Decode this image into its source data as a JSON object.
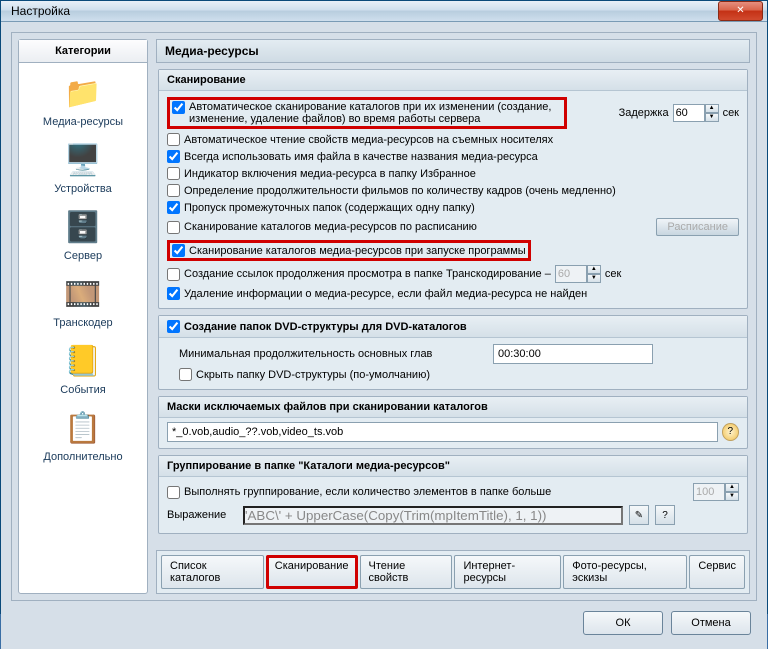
{
  "window": {
    "title": "Настройка"
  },
  "sidebar": {
    "tab": "Категории",
    "items": [
      {
        "label": "Медиа-ресурсы"
      },
      {
        "label": "Устройства"
      },
      {
        "label": "Сервер"
      },
      {
        "label": "Транскодер"
      },
      {
        "label": "События"
      },
      {
        "label": "Дополнительно"
      }
    ]
  },
  "content": {
    "title": "Медиа-ресурсы",
    "scan": {
      "header": "Сканирование",
      "c1": "Автоматическое сканирование каталогов при их изменении (создание, изменение, удаление файлов) во время работы сервера",
      "delay_label": "Задержка",
      "delay_value": "60",
      "delay_unit": "сек",
      "c2": "Автоматическое чтение свойств медиа-ресурсов на съемных носителях",
      "c3": "Всегда использовать имя файла в качестве названия медиа-ресурса",
      "c4": "Индикатор включения медиа-ресурса в папку Избранное",
      "c5": "Определение продолжительности фильмов по количеству кадров (очень медленно)",
      "c6": "Пропуск промежуточных папок  (содержащих одну папку)",
      "c7": "Сканирование каталогов медиа-ресурсов по расписанию",
      "sched_btn": "Расписание",
      "c8": "Сканирование каталогов медиа-ресурсов при запуске программы",
      "c9": "Создание ссылок продолжения просмотра в папке Транскодирование  –",
      "c9_val": "60",
      "c9_unit": "сек",
      "c10": "Удаление информации о медиа-ресурсе, если файл медиа-ресурса не найден"
    },
    "dvd": {
      "header": "Создание папок DVD-структуры для DVD-каталогов",
      "min_dur_label": "Минимальная продолжительность основных глав",
      "min_dur_value": "00:30:00",
      "hide": "Скрыть папку DVD-структуры  (по-умолчанию)"
    },
    "masks": {
      "header": "Маски исключаемых файлов  при сканировании каталогов",
      "value": "*_0.vob,audio_??.vob,video_ts.vob"
    },
    "group": {
      "header": "Группирование в папке \"Каталоги медиа-ресурсов\"",
      "c1": "Выполнять группирование, если количество элементов в папке больше",
      "c1_val": "100",
      "expr_label": "Выражение",
      "expr_value": "'ABC\\' + UpperCase(Copy(Trim(mpItemTitle), 1, 1))"
    },
    "tabs": [
      "Список каталогов",
      "Сканирование",
      "Чтение свойств",
      "Интернет-ресурсы",
      "Фото-ресурсы, эскизы",
      "Сервис"
    ]
  },
  "footer": {
    "ok": "ОК",
    "cancel": "Отмена"
  }
}
